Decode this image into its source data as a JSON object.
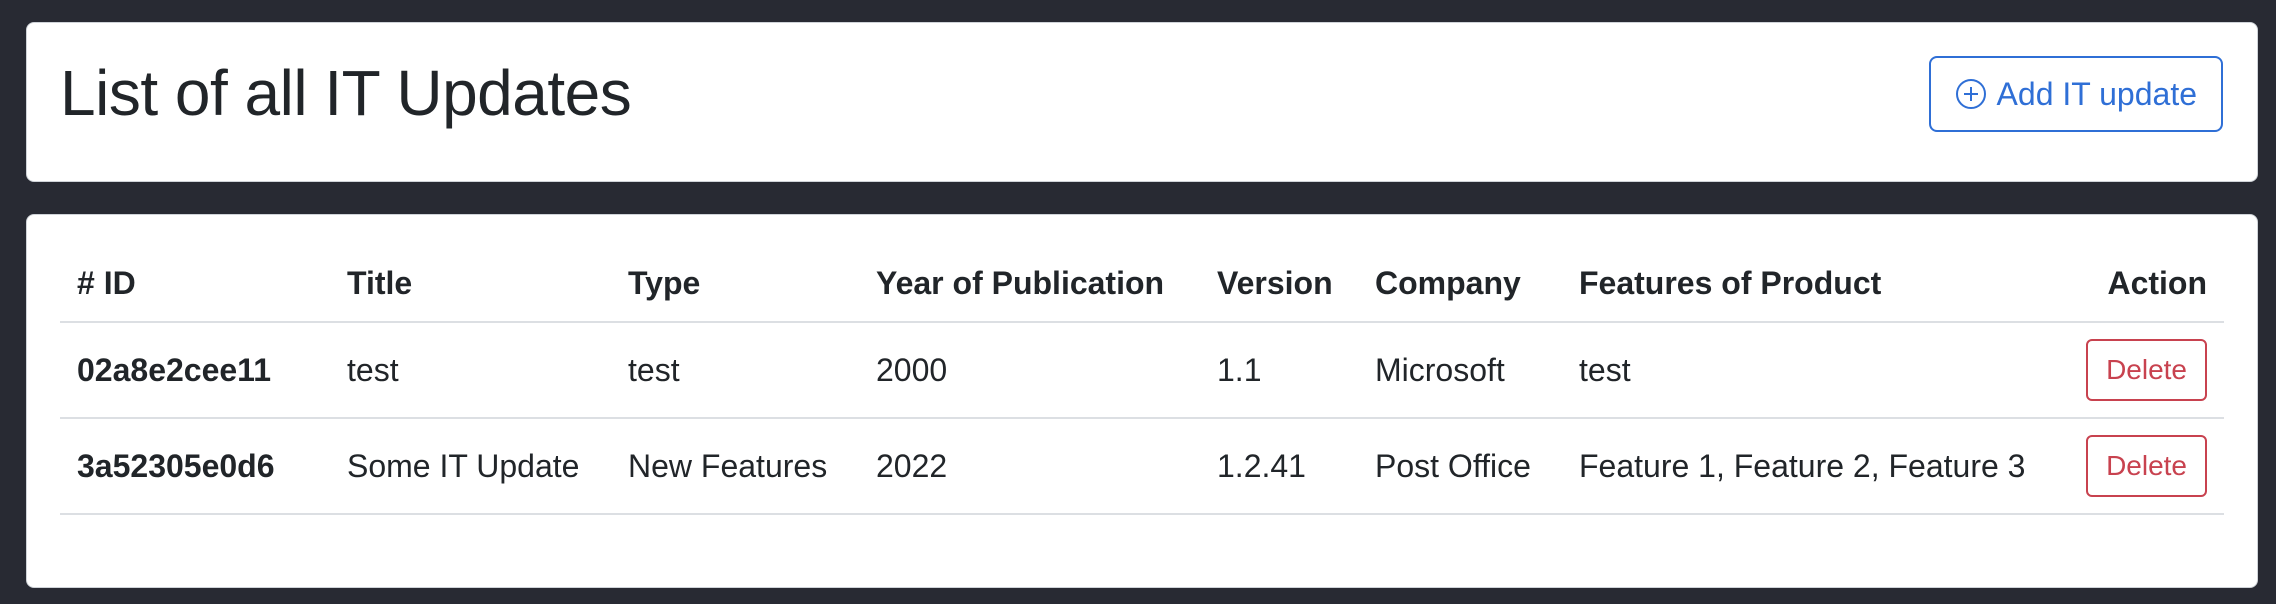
{
  "header": {
    "title": "List of all IT Updates",
    "add_button_label": "Add IT update",
    "add_button_icon": "plus-circle-icon",
    "accent_color": "#2f6fd6"
  },
  "table": {
    "columns": [
      "# ID",
      "Title",
      "Type",
      "Year of Publication",
      "Version",
      "Company",
      "Features of Product",
      "Action"
    ],
    "rows": [
      {
        "id": "02a8e2cee11",
        "title": "test",
        "type": "test",
        "year": "2000",
        "version": "1.1",
        "company": "Microsoft",
        "features": "test",
        "action_label": "Delete"
      },
      {
        "id": "3a52305e0d6",
        "title": "Some IT Update",
        "type": "New Features",
        "year": "2022",
        "version": "1.2.41",
        "company": "Post Office",
        "features": "Feature 1, Feature 2, Feature 3",
        "action_label": "Delete"
      }
    ],
    "delete_color": "#c8424f"
  },
  "colors": {
    "background": "#282a33",
    "card": "#ffffff"
  }
}
